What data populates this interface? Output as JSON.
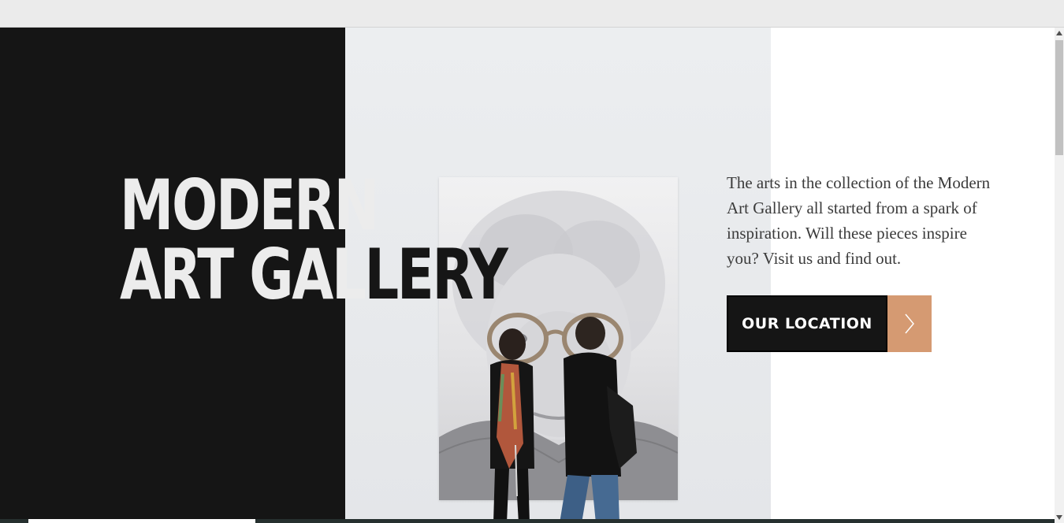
{
  "hero": {
    "title_line1": "MODERN",
    "title_line2_light": "ART GAL",
    "title_line2_dark": "LERY",
    "intro": "The arts in the collection of the Modern Art Gallery all started from a spark of inspiration. Will these pieces inspire you? Visit us and find out.",
    "cta_label": "OUR LOCATION",
    "cta_icon": "chevron-right-icon"
  },
  "colors": {
    "dark_panel": "#151515",
    "accent": "#d59a72",
    "text": "#3b3b3b"
  }
}
